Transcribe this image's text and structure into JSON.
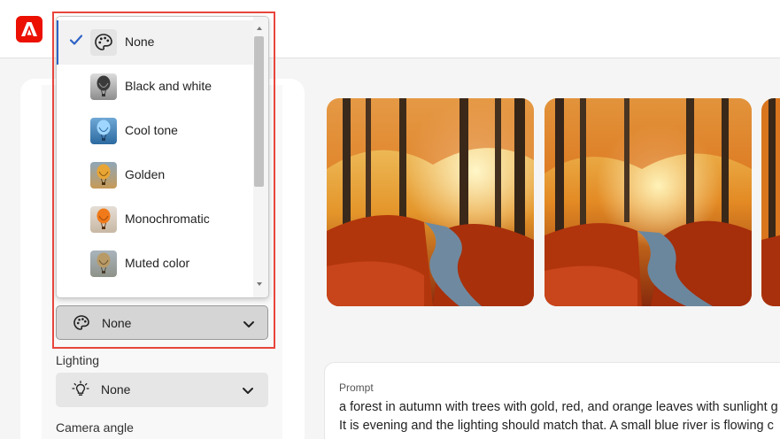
{
  "colors": {
    "brand": "#eb1000",
    "highlight": "#e8453c",
    "selected_accent": "#2f63c6"
  },
  "header": {
    "logo_icon": "adobe-firefly-logo-icon"
  },
  "effects_dropdown": {
    "options": [
      {
        "label": "None",
        "icon": "palette-icon",
        "selected": true
      },
      {
        "label": "Black and white",
        "icon": "balloon-bw-icon",
        "selected": false
      },
      {
        "label": "Cool tone",
        "icon": "balloon-cool-icon",
        "selected": false
      },
      {
        "label": "Golden",
        "icon": "balloon-golden-icon",
        "selected": false
      },
      {
        "label": "Monochromatic",
        "icon": "balloon-mono-icon",
        "selected": false
      },
      {
        "label": "Muted color",
        "icon": "balloon-muted-icon",
        "selected": false
      }
    ],
    "current_value": "None"
  },
  "lighting": {
    "label": "Lighting",
    "value": "None"
  },
  "camera_angle": {
    "label": "Camera angle"
  },
  "prompt": {
    "title": "Prompt",
    "line1": "a forest in autumn with trees with gold, red, and orange leaves with sunlight g",
    "line2": "It is evening and the lighting should match that. A small blue river is flowing c"
  }
}
